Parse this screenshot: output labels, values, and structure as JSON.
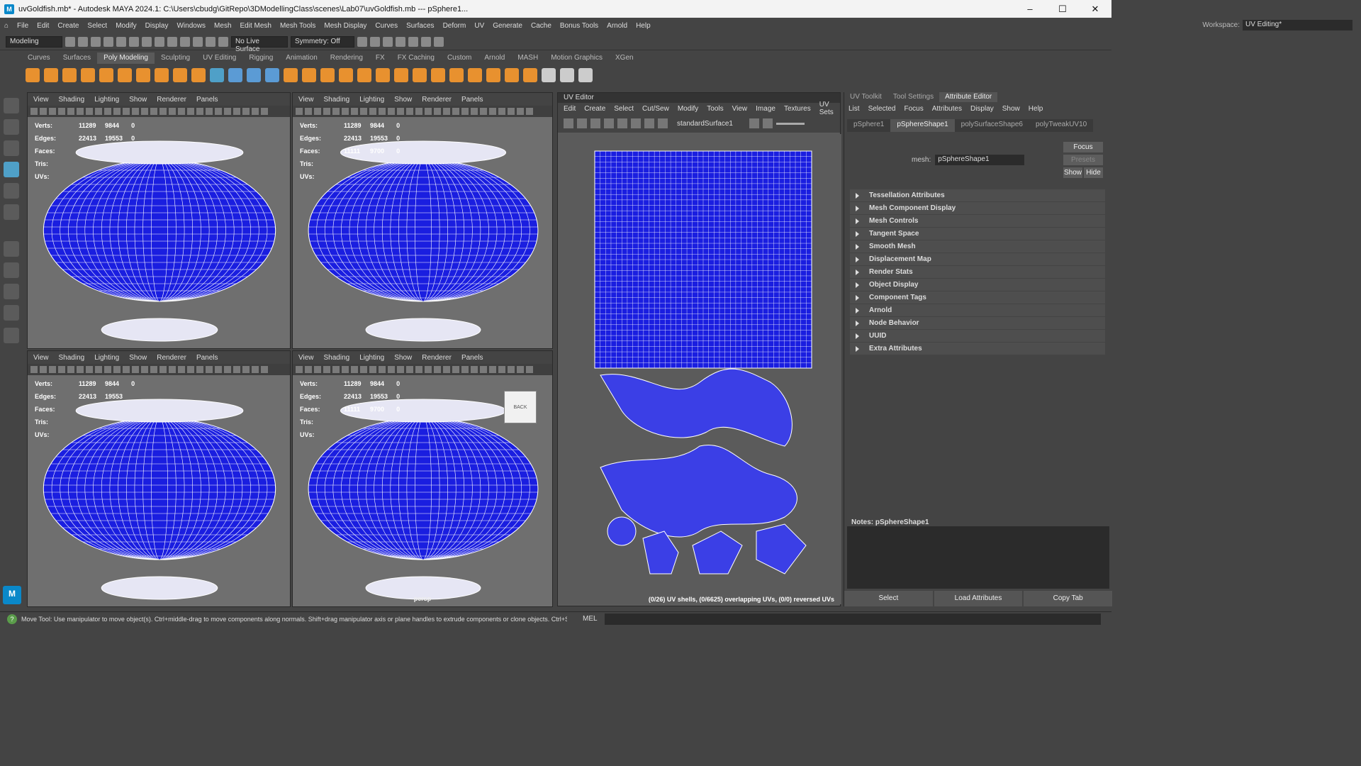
{
  "window": {
    "title": "uvGoldfish.mb* - Autodesk MAYA 2024.1: C:\\Users\\cbudg\\GitRepo\\3DModellingClass\\scenes\\Lab07\\uvGoldfish.mb  ---  pSphere1...",
    "controls": [
      "–",
      "☐",
      "✕"
    ]
  },
  "menubar": [
    "File",
    "Edit",
    "Create",
    "Select",
    "Modify",
    "Display",
    "Windows",
    "Mesh",
    "Edit Mesh",
    "Mesh Tools",
    "Mesh Display",
    "Curves",
    "Surfaces",
    "Deform",
    "UV",
    "Generate",
    "Cache",
    "Bonus Tools",
    "Arnold",
    "Help"
  ],
  "workspace": {
    "label": "Workspace:",
    "value": "UV Editing*"
  },
  "statusline": {
    "menuset": "Modeling",
    "live_surface": "No Live Surface",
    "symmetry": "Symmetry: Off"
  },
  "shelf_tabs": {
    "items": [
      "Curves",
      "Surfaces",
      "Poly Modeling",
      "Sculpting",
      "UV Editing",
      "Rigging",
      "Animation",
      "Rendering",
      "FX",
      "FX Caching",
      "Custom",
      "Arnold",
      "MASH",
      "Motion Graphics",
      "XGen"
    ],
    "active": "Poly Modeling"
  },
  "shelf_icon_colors": [
    "#e8912f",
    "#e8912f",
    "#e8912f",
    "#e8912f",
    "#e8912f",
    "#e8912f",
    "#e8912f",
    "#e8912f",
    "#e8912f",
    "#e8912f",
    "#4fa0c8",
    "#5b9bd5",
    "#5b9bd5",
    "#5b9bd5",
    "#e8912f",
    "#e8912f",
    "#e8912f",
    "#e8912f",
    "#e8912f",
    "#e8912f",
    "#e8912f",
    "#e8912f",
    "#e8912f",
    "#e8912f",
    "#e8912f",
    "#e8912f",
    "#e8912f",
    "#e8912f",
    "#cccccc",
    "#cccccc",
    "#cccccc"
  ],
  "viewport_menu": [
    "View",
    "Shading",
    "Lighting",
    "Show",
    "Renderer",
    "Panels"
  ],
  "hud_labels": [
    "Verts:",
    "Edges:",
    "Faces:",
    "Tris:",
    "UVs:"
  ],
  "viewports": [
    {
      "hud": [
        [
          "11289",
          "9844",
          "0"
        ],
        [
          "22413",
          "19553",
          "0"
        ],
        [
          "",
          "",
          ""
        ],
        [
          "",
          "",
          ""
        ],
        [
          "",
          "",
          ""
        ]
      ],
      "label": ""
    },
    {
      "hud": [
        [
          "11289",
          "9844",
          "0"
        ],
        [
          "22413",
          "19553",
          "0"
        ],
        [
          "11111",
          "9700",
          "0"
        ],
        [
          "",
          "",
          ""
        ],
        [
          "",
          "",
          ""
        ]
      ],
      "label": ""
    },
    {
      "hud": [
        [
          "11289",
          "9844",
          "0"
        ],
        [
          "22413",
          "19553",
          ""
        ],
        [
          "",
          "",
          ""
        ],
        [
          "",
          "",
          ""
        ],
        [
          "",
          "",
          ""
        ]
      ],
      "label": ""
    },
    {
      "hud": [
        [
          "11289",
          "9844",
          "0"
        ],
        [
          "22413",
          "19553",
          "0"
        ],
        [
          "11111",
          "9700",
          "0"
        ],
        [
          "",
          "",
          ""
        ],
        [
          "",
          "",
          ""
        ]
      ],
      "label": "persp"
    }
  ],
  "viewcube": {
    "face": "BACK"
  },
  "uv_editor": {
    "title": "UV Editor",
    "menu": [
      "Edit",
      "Create",
      "Select",
      "Cut/Sew",
      "Modify",
      "Tools",
      "View",
      "Image",
      "Textures",
      "UV Sets"
    ],
    "shader": "standardSurface1",
    "status": "(0/26) UV shells, (0/6625) overlapping UVs, (0/0) reversed UVs"
  },
  "attribute_editor": {
    "tabs": [
      "UV Toolkit",
      "Tool Settings",
      "Attribute Editor"
    ],
    "active_tab": "Attribute Editor",
    "menu": [
      "List",
      "Selected",
      "Focus",
      "Attributes",
      "Display",
      "Show",
      "Help"
    ],
    "nodes": [
      "pSphere1",
      "pSphereShape1",
      "polySurfaceShape6",
      "polyTweakUV10"
    ],
    "active_node": "pSphereShape1",
    "mesh_label": "mesh:",
    "mesh_value": "pSphereShape1",
    "focus": "Focus",
    "presets": "Presets",
    "show": "Show",
    "hide": "Hide",
    "sections": [
      "Tessellation Attributes",
      "Mesh Component Display",
      "Mesh Controls",
      "Tangent Space",
      "Smooth Mesh",
      "Displacement Map",
      "Render Stats",
      "Object Display",
      "Component Tags",
      "Arnold",
      "Node Behavior",
      "UUID",
      "Extra Attributes"
    ],
    "notes_label": "Notes:  pSphereShape1",
    "bottom_buttons": [
      "Select",
      "Load Attributes",
      "Copy Tab"
    ]
  },
  "helpline": {
    "text": "Move Tool: Use manipulator to move object(s). Ctrl+middle-drag to move components along normals. Shift+drag manipulator axis or plane handles to extrude components or clone objects. Ctrl+Shift+drag to constrain",
    "mel": "MEL"
  },
  "logo": "M",
  "colors": {
    "wireframe_blue": "#1a1ee0",
    "viewport_bg": "#6f6f6f",
    "uv_bg": "#5b5b5b"
  }
}
